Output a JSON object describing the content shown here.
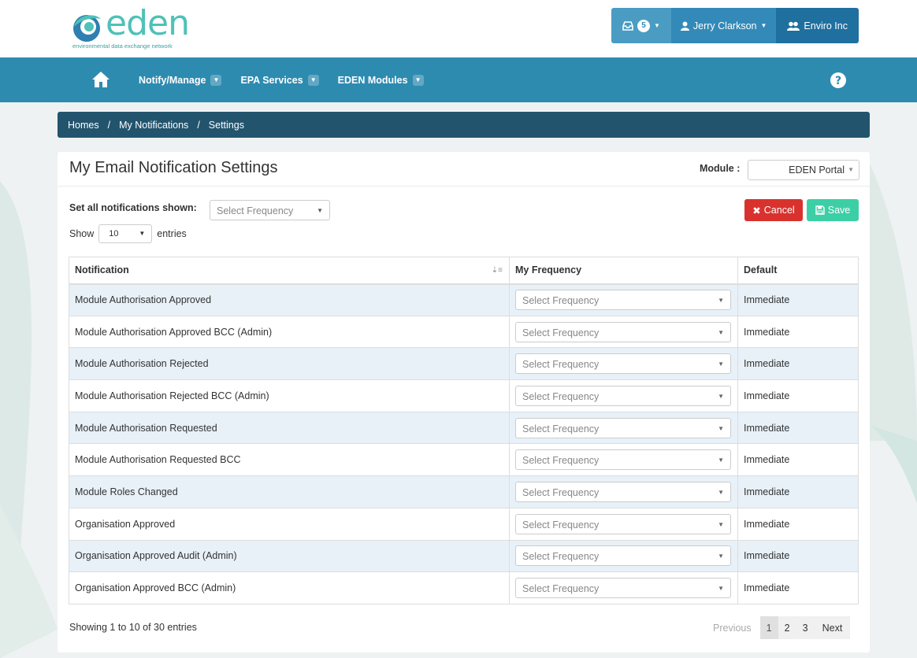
{
  "brand": {
    "name": "eden",
    "tagline": "environmental data exchange network"
  },
  "user_bar": {
    "inbox_count": "5",
    "user_name": "Jerry Clarkson",
    "org_name": "Enviro Inc"
  },
  "nav": {
    "items": [
      {
        "label": "Notify/Manage"
      },
      {
        "label": "EPA Services"
      },
      {
        "label": "EDEN Modules"
      }
    ]
  },
  "breadcrumb": {
    "items": [
      "Homes",
      "My Notifications",
      "Settings"
    ]
  },
  "page": {
    "title": "My Email Notification Settings",
    "module_label": "Module :",
    "module_value": "EDEN Portal",
    "set_all_label": "Set all notifications shown:",
    "set_all_placeholder": "Select Frequency",
    "cancel_label": "Cancel",
    "save_label": "Save",
    "show_label": "Show",
    "show_value": "10",
    "entries_label": "entries"
  },
  "table": {
    "headers": [
      "Notification",
      "My Frequency",
      "Default"
    ],
    "rows": [
      {
        "notification": "Module Authorisation Approved",
        "frequency": "Select Frequency",
        "default": "Immediate"
      },
      {
        "notification": "Module Authorisation Approved BCC (Admin)",
        "frequency": "Select Frequency",
        "default": "Immediate"
      },
      {
        "notification": "Module Authorisation Rejected",
        "frequency": "Select Frequency",
        "default": "Immediate"
      },
      {
        "notification": "Module Authorisation Rejected BCC (Admin)",
        "frequency": "Select Frequency",
        "default": "Immediate"
      },
      {
        "notification": "Module Authorisation Requested",
        "frequency": "Select Frequency",
        "default": "Immediate"
      },
      {
        "notification": "Module Authorisation Requested BCC",
        "frequency": "Select Frequency",
        "default": "Immediate"
      },
      {
        "notification": "Module Roles Changed",
        "frequency": "Select Frequency",
        "default": "Immediate"
      },
      {
        "notification": "Organisation Approved",
        "frequency": "Select Frequency",
        "default": "Immediate"
      },
      {
        "notification": "Organisation Approved Audit (Admin)",
        "frequency": "Select Frequency",
        "default": "Immediate"
      },
      {
        "notification": "Organisation Approved BCC (Admin)",
        "frequency": "Select Frequency",
        "default": "Immediate"
      }
    ]
  },
  "pagination": {
    "summary": "Showing 1 to 10 of 30 entries",
    "previous": "Previous",
    "pages": [
      "1",
      "2",
      "3"
    ],
    "current": "1",
    "next": "Next"
  },
  "colors": {
    "nav_bg": "#2e8bb0",
    "breadcrumb_bg": "#22546e",
    "cancel": "#d9322e",
    "save": "#3ccfa5",
    "brand": "#4fc1b8"
  }
}
